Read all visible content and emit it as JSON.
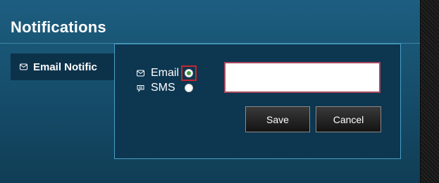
{
  "page": {
    "title": "Notifications"
  },
  "sidebar": {
    "items": [
      {
        "label": "Email Notific",
        "icon": "envelope-icon"
      }
    ]
  },
  "dialog": {
    "options": [
      {
        "label": "Email",
        "icon": "envelope-icon",
        "selected": true
      },
      {
        "label": "SMS",
        "icon": "chat-bubble-icon",
        "selected": false
      }
    ],
    "input": {
      "value": "",
      "placeholder": ""
    },
    "save_label": "Save",
    "cancel_label": "Cancel"
  },
  "colors": {
    "panel": "#1d5e80",
    "dialog": "#0d3650",
    "dialog_border": "#4a9fc6",
    "focus_ring": "#c8262e",
    "radio_selected": "#3f9b3c"
  }
}
